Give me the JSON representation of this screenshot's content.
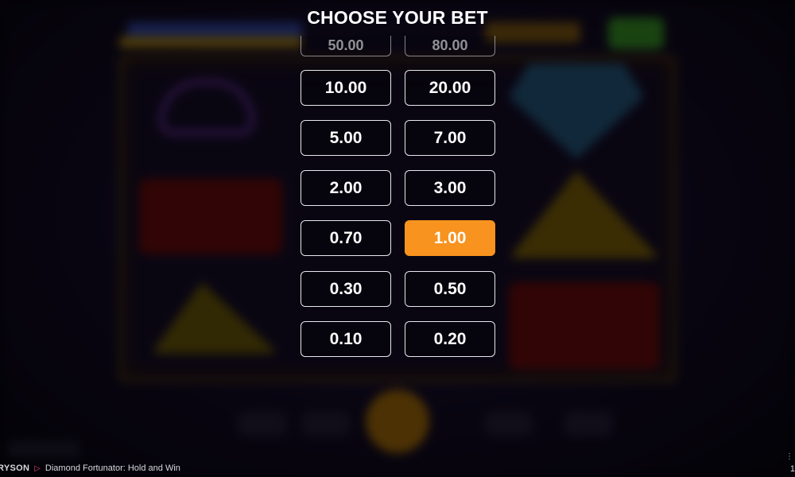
{
  "dialog": {
    "title": "CHOOSE YOUR BET"
  },
  "bets": {
    "partial_left": "50.00",
    "partial_right": "80.00",
    "rows": [
      {
        "left": "10.00",
        "right": "20.00"
      },
      {
        "left": "5.00",
        "right": "7.00"
      },
      {
        "left": "2.00",
        "right": "3.00"
      },
      {
        "left": "0.70",
        "right": "1.00"
      },
      {
        "left": "0.30",
        "right": "0.50"
      },
      {
        "left": "0.10",
        "right": "0.20"
      }
    ],
    "selected": "1.00",
    "selected_color": "#f7931e"
  },
  "footer": {
    "brand": "RYSON",
    "game_title": "Diamond Fortunator: Hold and Win",
    "corner_text": "1"
  },
  "colors": {
    "accent": "#f7931e",
    "button_border": "#e8e8ee",
    "background": "#07050d"
  }
}
